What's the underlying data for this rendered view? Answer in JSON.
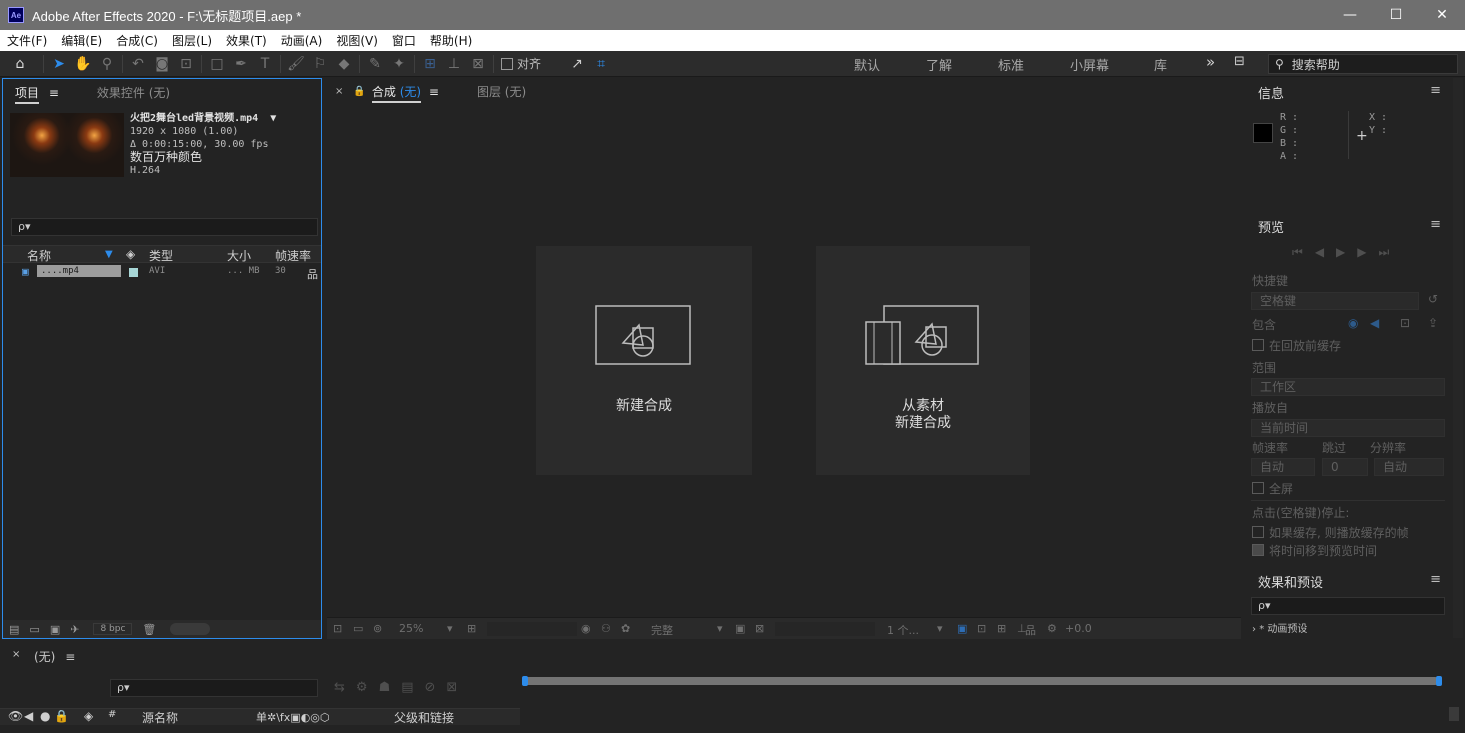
{
  "window": {
    "app_icon_text": "Ae",
    "title": "Adobe After Effects 2020 - F:\\无标题项目.aep *",
    "minimize_glyph": "—",
    "maximize_glyph": "☐",
    "close_glyph": "✕"
  },
  "menu": [
    "文件(F)",
    "编辑(E)",
    "合成(C)",
    "图层(L)",
    "效果(T)",
    "动画(A)",
    "视图(V)",
    "窗口",
    "帮助(H)"
  ],
  "toolbar": {
    "snap_label": "对齐",
    "workspaces": [
      "默认",
      "了解",
      "标准",
      "小屏幕",
      "库"
    ],
    "more_glyph": "»",
    "search_help_placeholder": "搜索帮助"
  },
  "project_panel": {
    "tab_project": "项目",
    "tab_effects": "效果控件 (无)",
    "selected_file": {
      "name": "火把2舞台led背景视频.mp4",
      "dimensions": "1920 x 1080 (1.00)",
      "duration": "Δ 0:00:15:00, 30.00 fps",
      "colors": "数百万种颜色",
      "codec": "H.264"
    },
    "search_placeholder": "ρ▾",
    "columns": [
      "名称",
      "类型",
      "大小",
      "帧速率"
    ],
    "items": [
      {
        "name": "....mp4",
        "type": "AVI",
        "size": "... MB",
        "fps": "30"
      }
    ],
    "bpc": "8 bpc"
  },
  "composition_panel": {
    "tab_comp_prefix": "合成",
    "tab_comp_value": "(无)",
    "tab_layer": "图层 (无)",
    "card_new_comp": "新建合成",
    "card_from_footage_line1": "从素材",
    "card_from_footage_line2": "新建合成",
    "footer": {
      "zoom": "25%",
      "resolution": "完整",
      "views": "1 个...",
      "exposure": "+0.0"
    }
  },
  "info_panel": {
    "title": "信息",
    "channels": [
      "R :",
      "G :",
      "B :",
      "A :"
    ],
    "coords": [
      "X :",
      "Y :"
    ]
  },
  "preview_panel": {
    "title": "预览",
    "shortcut_label": "快捷键",
    "shortcut_value": "空格键",
    "include_label": "包含",
    "cache_before_label": "在回放前缓存",
    "range_label": "范围",
    "range_value": "工作区",
    "play_from_label": "播放自",
    "play_from_value": "当前时间",
    "fps_label": "帧速率",
    "skip_label": "跳过",
    "res_label": "分辨率",
    "fps_value": "自动",
    "skip_value": "0",
    "res_value": "自动",
    "fullscreen_label": "全屏",
    "stop_label": "点击(空格键)停止:",
    "stop_opt1": "如果缓存, 则播放缓存的帧",
    "stop_opt2": "将时间移到预览时间"
  },
  "effects_panel": {
    "title": "效果和预设",
    "search_placeholder": "ρ▾",
    "first_item": "* 动画预设"
  },
  "timeline": {
    "tab": "(无)",
    "search_placeholder": "ρ▾",
    "col_source_name": "源名称",
    "col_parent": "父级和链接",
    "col_hash": "#"
  }
}
